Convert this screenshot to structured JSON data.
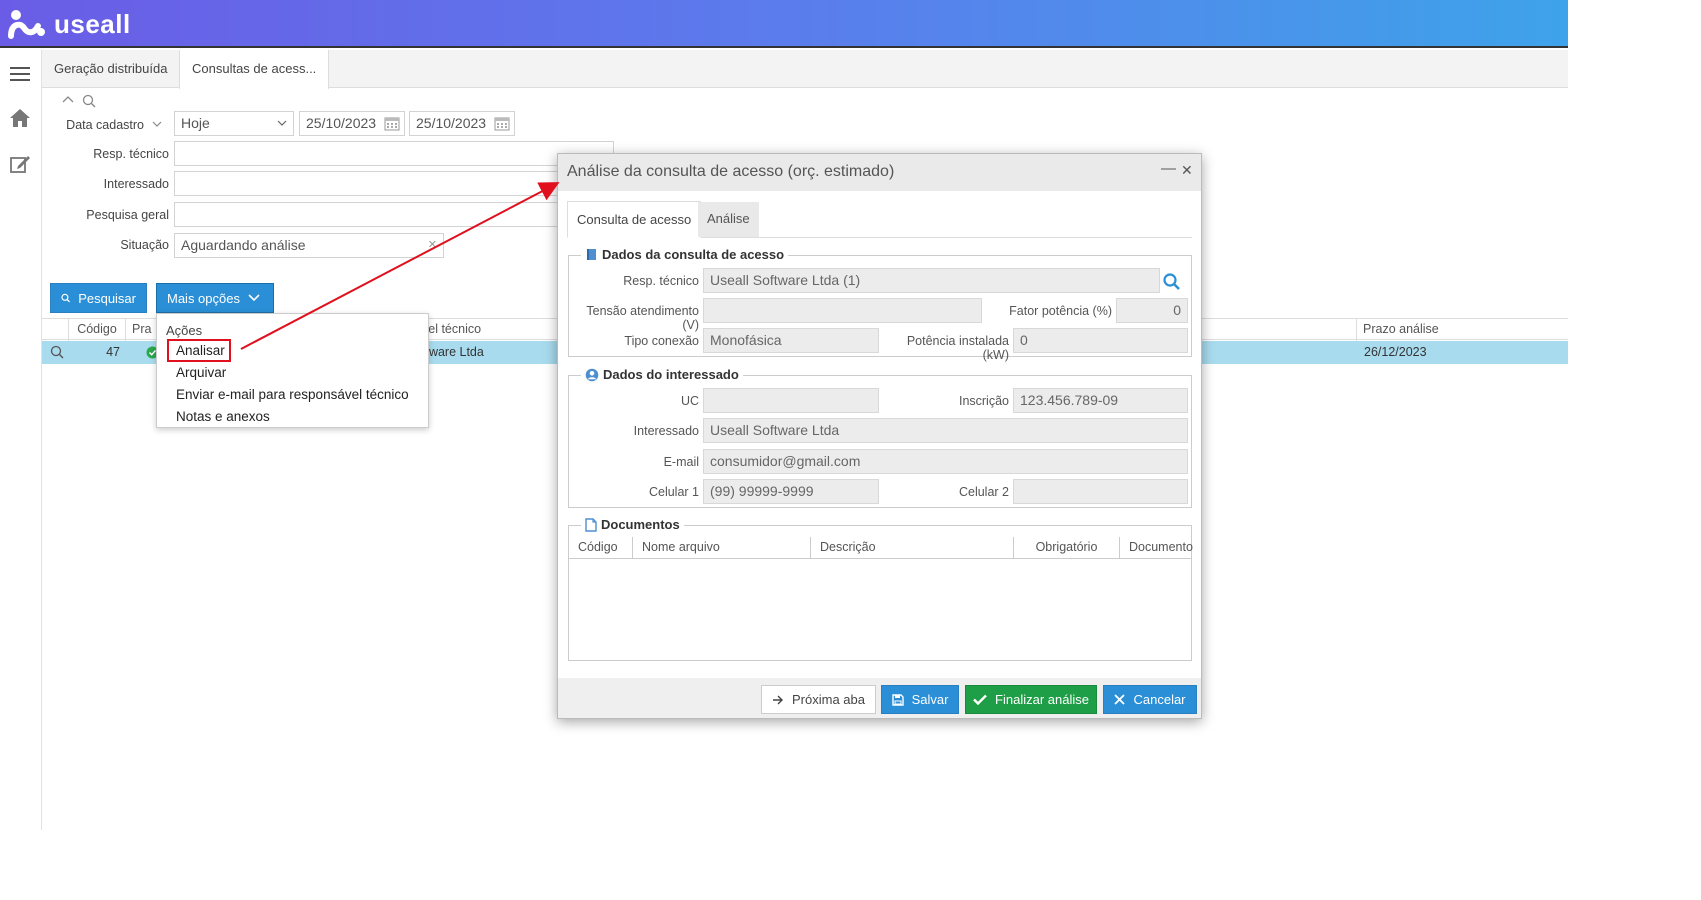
{
  "brand": {
    "name": "useall"
  },
  "tabs": [
    {
      "label": "Geração distribuída"
    },
    {
      "label": "Consultas de acess..."
    }
  ],
  "filter": {
    "data_cadastro_label": "Data cadastro",
    "periodo": "Hoje",
    "data_inicio": "25/10/2023",
    "data_fim": "25/10/2023",
    "resp_tecnico_label": "Resp. técnico",
    "interessado_label": "Interessado",
    "pesquisa_geral_label": "Pesquisa geral",
    "situacao_label": "Situação",
    "situacao_value": "Aguardando análise"
  },
  "buttons": {
    "pesquisar": "Pesquisar",
    "mais_opcoes": "Mais opções"
  },
  "grid": {
    "headers": {
      "codigo": "Código",
      "prazo_col": "Pra",
      "resp_col": "vel técnico",
      "prazo_analise": "Prazo análise"
    },
    "row": {
      "codigo": "47",
      "resp": "ftware Ltda",
      "prazo_analise": "26/12/2023"
    }
  },
  "menu": {
    "header": "Ações",
    "items": [
      "Analisar",
      "Arquivar",
      "Enviar e-mail para responsável técnico",
      "Notas e anexos"
    ]
  },
  "modal": {
    "title": "Análise da consulta de acesso (orç. estimado)",
    "tabs": [
      "Consulta de acesso",
      "Análise"
    ],
    "dados_consulta": {
      "title": "Dados da consulta de acesso",
      "resp_tecnico_label": "Resp. técnico",
      "resp_tecnico_value": "Useall Software Ltda (1)",
      "tensao_label": "Tensão atendimento (V)",
      "tensao_value": "",
      "fator_label": "Fator potência (%)",
      "fator_value": "0",
      "tipo_conexao_label": "Tipo conexão",
      "tipo_conexao_value": "Monofásica",
      "potencia_label": "Potência instalada (kW)",
      "potencia_value": "0"
    },
    "dados_interessado": {
      "title": "Dados do interessado",
      "uc_label": "UC",
      "uc_value": "",
      "inscricao_label": "Inscrição",
      "inscricao_value": "123.456.789-09",
      "interessado_label": "Interessado",
      "interessado_value": "Useall Software Ltda",
      "email_label": "E-mail",
      "email_value": "consumidor@gmail.com",
      "celular1_label": "Celular 1",
      "celular1_value": "(99) 99999-9999",
      "celular2_label": "Celular 2",
      "celular2_value": ""
    },
    "documentos": {
      "title": "Documentos",
      "headers": [
        "Código",
        "Nome arquivo",
        "Descrição",
        "Obrigatório",
        "Documento"
      ]
    },
    "footer": {
      "proxima_aba": "Próxima aba",
      "salvar": "Salvar",
      "finalizar": "Finalizar análise",
      "cancelar": "Cancelar"
    }
  },
  "colors": {
    "primary": "#2a8fd6",
    "success": "#1e9e46",
    "highlight": "#e0101e",
    "row_selected": "#a9dbef"
  }
}
